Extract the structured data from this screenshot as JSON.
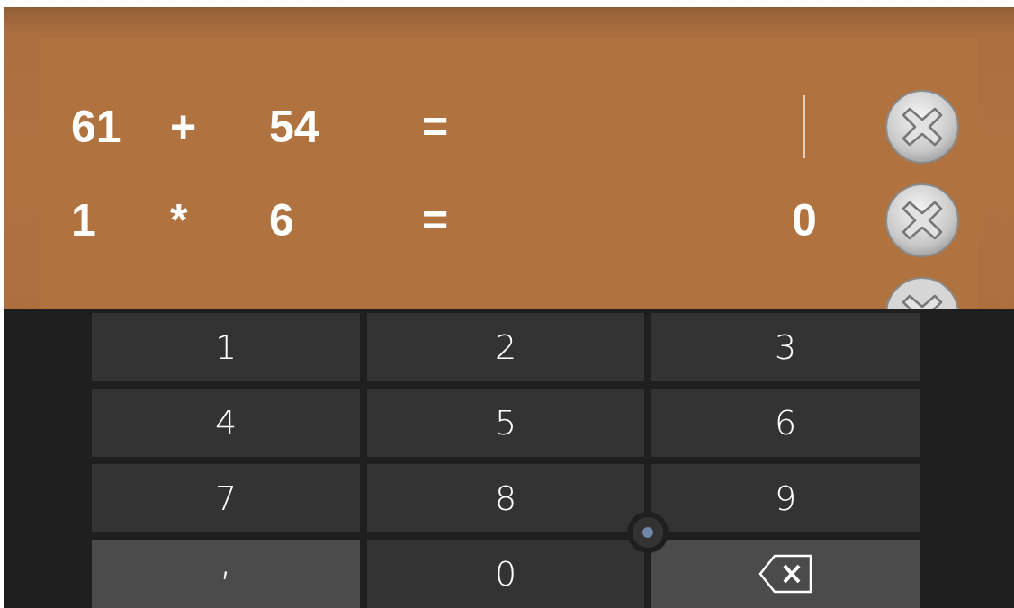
{
  "problems": [
    {
      "a": "61",
      "op": "+",
      "b": "54",
      "eq": "=",
      "answer": {
        "focused": true
      }
    },
    {
      "a": "1",
      "op": "*",
      "b": "6",
      "eq": "=",
      "answer": {
        "value": "0",
        "focused": false
      }
    }
  ],
  "keyboard": {
    "keys": [
      {
        "kind": "digit",
        "label": "1"
      },
      {
        "kind": "digit",
        "label": "2"
      },
      {
        "kind": "digit",
        "label": "3"
      },
      {
        "kind": "digit",
        "label": "4"
      },
      {
        "kind": "digit",
        "label": "5"
      },
      {
        "kind": "digit",
        "label": "6"
      },
      {
        "kind": "digit",
        "label": "7"
      },
      {
        "kind": "digit",
        "label": "8"
      },
      {
        "kind": "digit",
        "label": "9"
      },
      {
        "kind": "symbol",
        "label": ","
      },
      {
        "kind": "digit",
        "label": "0"
      },
      {
        "kind": "backspace"
      }
    ]
  }
}
